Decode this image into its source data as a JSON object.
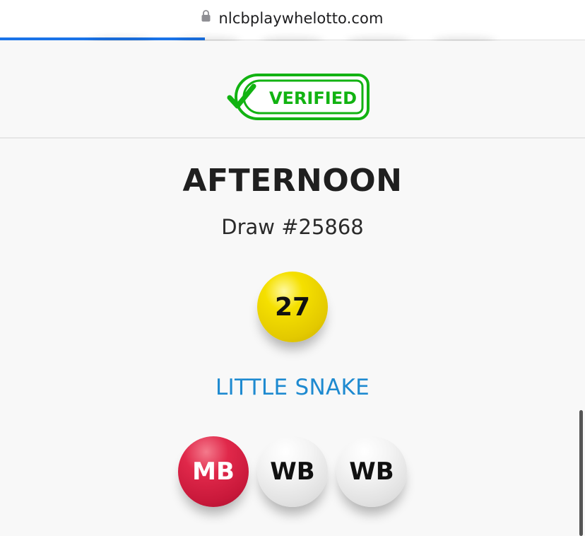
{
  "browser": {
    "url": "nlcbplaywhelotto.com",
    "progress": 0.35
  },
  "badge": {
    "label": "VERIFIED",
    "color": "#12b312"
  },
  "draw": {
    "title": "AFTERNOON",
    "number": "Draw #25868",
    "winning_number": "27",
    "mark_name": "LITTLE SNAKE",
    "mark_color": "#1e8ad0",
    "balls": [
      {
        "label": "MB",
        "color": "#d62244"
      },
      {
        "label": "WB",
        "color": "#ececec"
      },
      {
        "label": "WB",
        "color": "#ececec"
      }
    ]
  },
  "icons": {
    "lock": "lock-icon",
    "check": "check-icon"
  }
}
